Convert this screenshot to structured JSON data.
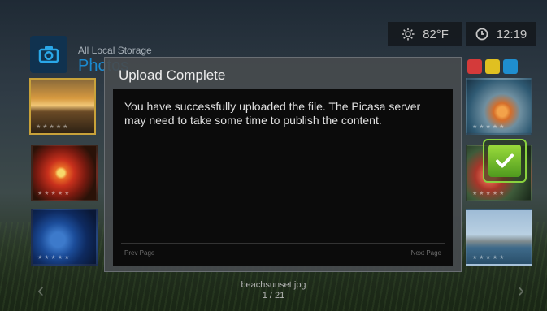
{
  "header": {
    "source_label": "All Local Storage",
    "section_title": "Photos"
  },
  "status": {
    "temperature": "82°F",
    "time": "12:19"
  },
  "function_buttons": [
    {
      "name": "red",
      "color": "#d43a3a"
    },
    {
      "name": "yellow",
      "color": "#e0c021"
    },
    {
      "name": "blue",
      "color": "#1f8ecf"
    }
  ],
  "dialog": {
    "title": "Upload Complete",
    "message": "You have successfully uploaded the file. The Picasa server may need to take some time to publish the content.",
    "prev_page": "Prev Page",
    "next_page": "Next Page"
  },
  "footer": {
    "filename": "beachsunset.jpg",
    "page": "1 / 21"
  },
  "colors": {
    "accent_blue": "#1b8ad0",
    "confirm_green": "#8ad23e",
    "selected_border": "#c8a23a"
  }
}
